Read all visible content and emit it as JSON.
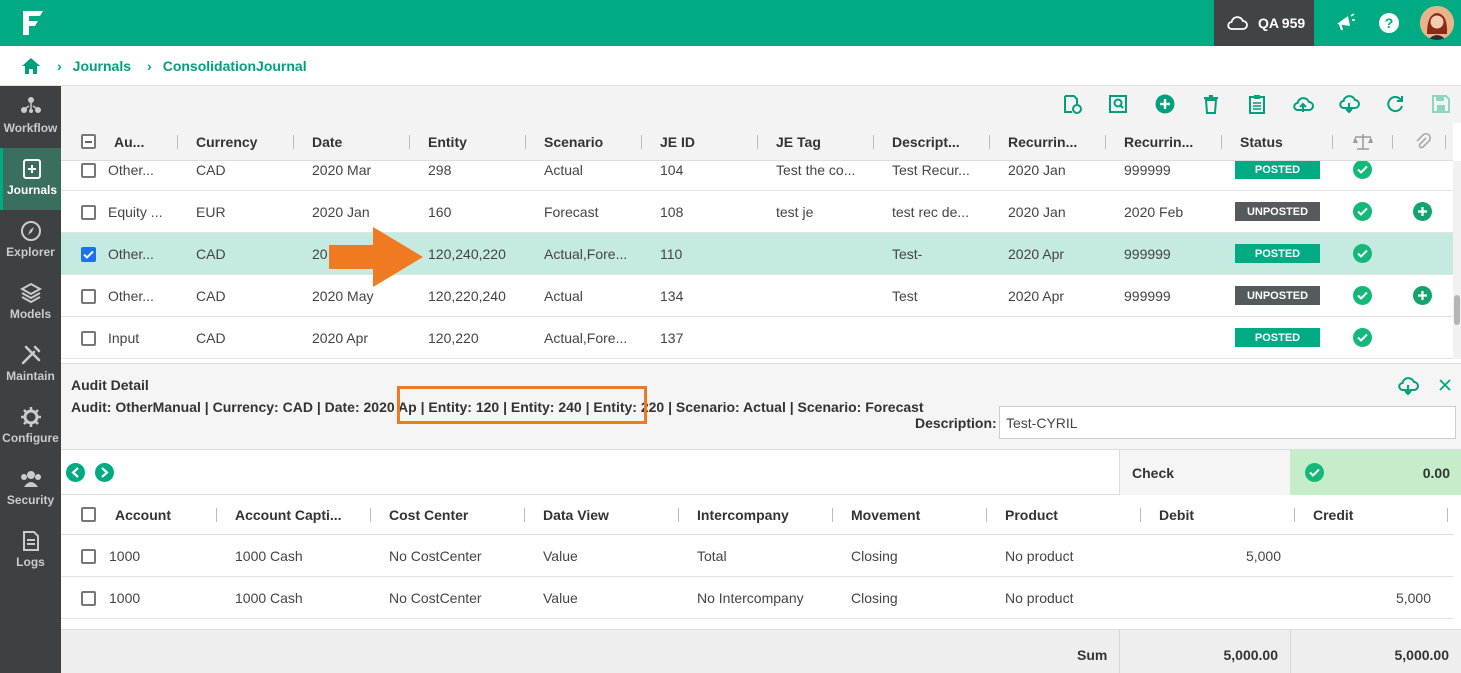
{
  "topbar": {
    "environment": "QA 959"
  },
  "breadcrumb": {
    "items": [
      "Journals",
      "ConsolidationJournal"
    ]
  },
  "sidebar": {
    "items": [
      {
        "label": "Workflow",
        "icon": "workflow-icon"
      },
      {
        "label": "Journals",
        "icon": "journals-icon",
        "active": true
      },
      {
        "label": "Explorer",
        "icon": "compass-icon"
      },
      {
        "label": "Models",
        "icon": "layers-icon"
      },
      {
        "label": "Maintain",
        "icon": "tools-icon"
      },
      {
        "label": "Configure",
        "icon": "gear-icon"
      },
      {
        "label": "Security",
        "icon": "users-icon"
      },
      {
        "label": "Logs",
        "icon": "document-icon"
      }
    ]
  },
  "colors": {
    "brand": "#00ab84",
    "sidebar": "#3d4144",
    "posted": "#00ab84",
    "unposted": "#555a5d",
    "selected_row": "#c4eae1",
    "highlight": "#f07a22"
  },
  "journal_grid": {
    "headers": [
      "Au...",
      "Currency",
      "Date",
      "Entity",
      "Scenario",
      "JE ID",
      "JE Tag",
      "Descript...",
      "Recurrin...",
      "Recurrin...",
      "Status"
    ],
    "rows": [
      {
        "audit": "Other...",
        "currency": "CAD",
        "date": "2020 Mar",
        "entity": "298",
        "scenario": "Actual",
        "je_id": "104",
        "je_tag": "Test the co...",
        "description": "Test Recur...",
        "recur1": "2020 Jan",
        "recur2": "999999",
        "status": "POSTED",
        "status_type": "posted",
        "checked": false,
        "has_add": false
      },
      {
        "audit": "Equity ...",
        "currency": "EUR",
        "date": "2020 Jan",
        "entity": "160",
        "scenario": "Forecast",
        "je_id": "108",
        "je_tag": "test je",
        "description": "test rec de...",
        "recur1": "2020 Jan",
        "recur2": "2020 Feb",
        "status": "UNPOSTED",
        "status_type": "unposted",
        "checked": false,
        "has_add": true
      },
      {
        "audit": "Other...",
        "currency": "CAD",
        "date": "20",
        "entity": "120,240,220",
        "scenario": "Actual,Fore...",
        "je_id": "110",
        "je_tag": "",
        "description": "Test-",
        "recur1": "2020 Apr",
        "recur2": "999999",
        "status": "POSTED",
        "status_type": "posted",
        "checked": true,
        "has_add": false
      },
      {
        "audit": "Other...",
        "currency": "CAD",
        "date": "2020 May",
        "entity": "120,220,240",
        "scenario": "Actual",
        "je_id": "134",
        "je_tag": "",
        "description": "Test",
        "recur1": "2020 Apr",
        "recur2": "999999",
        "status": "UNPOSTED",
        "status_type": "unposted",
        "checked": false,
        "has_add": true
      },
      {
        "audit": "Input",
        "currency": "CAD",
        "date": "2020 Apr",
        "entity": "120,220",
        "scenario": "Actual,Fore...",
        "je_id": "137",
        "je_tag": "",
        "description": "",
        "recur1": "",
        "recur2": "",
        "status": "POSTED",
        "status_type": "posted",
        "checked": false,
        "has_add": false
      }
    ]
  },
  "audit_detail": {
    "title": "Audit Detail",
    "line_before": "Audit: OtherManual | Currency: CAD | Date: 2020 Ap",
    "line_highlight": "| Entity: 120 | Entity: 240 | Entity: 220 |",
    "line_after": " Scenario: Actual | Scenario: Forecast",
    "description_label": "Description:",
    "description_value": "Test-CYRIL"
  },
  "check": {
    "label": "Check",
    "value": "0.00"
  },
  "detail_grid": {
    "headers": [
      "Account",
      "Account Capti...",
      "Cost Center",
      "Data View",
      "Intercompany",
      "Movement",
      "Product",
      "Debit",
      "Credit"
    ],
    "rows": [
      {
        "account": "1000",
        "caption": "1000 Cash",
        "cost_center": "No CostCenter",
        "data_view": "Value",
        "intercompany": "Total",
        "movement": "Closing",
        "product": "No product",
        "debit": "5,000",
        "credit": ""
      },
      {
        "account": "1000",
        "caption": "1000 Cash",
        "cost_center": "No CostCenter",
        "data_view": "Value",
        "intercompany": "No Intercompany",
        "movement": "Closing",
        "product": "No product",
        "debit": "",
        "credit": "5,000"
      }
    ]
  },
  "sum": {
    "label": "Sum",
    "debit": "5,000.00",
    "credit": "5,000.00"
  }
}
